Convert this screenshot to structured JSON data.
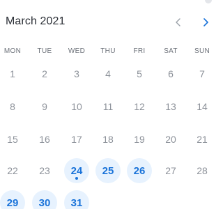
{
  "calendar": {
    "month_label": "March 2021",
    "weekdays": [
      "MON",
      "TUE",
      "WED",
      "THU",
      "FRI",
      "SAT",
      "SUN"
    ],
    "weeks": [
      [
        "1",
        "2",
        "3",
        "4",
        "5",
        "6",
        "7"
      ],
      [
        "8",
        "9",
        "10",
        "11",
        "12",
        "13",
        "14"
      ],
      [
        "15",
        "16",
        "17",
        "18",
        "19",
        "20",
        "21"
      ],
      [
        "22",
        "23",
        "24",
        "25",
        "26",
        "27",
        "28"
      ],
      [
        "29",
        "30",
        "31",
        null,
        null,
        null,
        null
      ]
    ],
    "available_days": [
      "24",
      "25",
      "26",
      "29",
      "30",
      "31"
    ],
    "today": "24",
    "prev_icon": "chevron-left-icon",
    "next_icon": "chevron-right-icon"
  },
  "colors": {
    "accent": "#1a73d9",
    "available_bg": "#e7f2fe",
    "muted_text": "#8c9199",
    "nav_prev": "#9aa0a8"
  }
}
